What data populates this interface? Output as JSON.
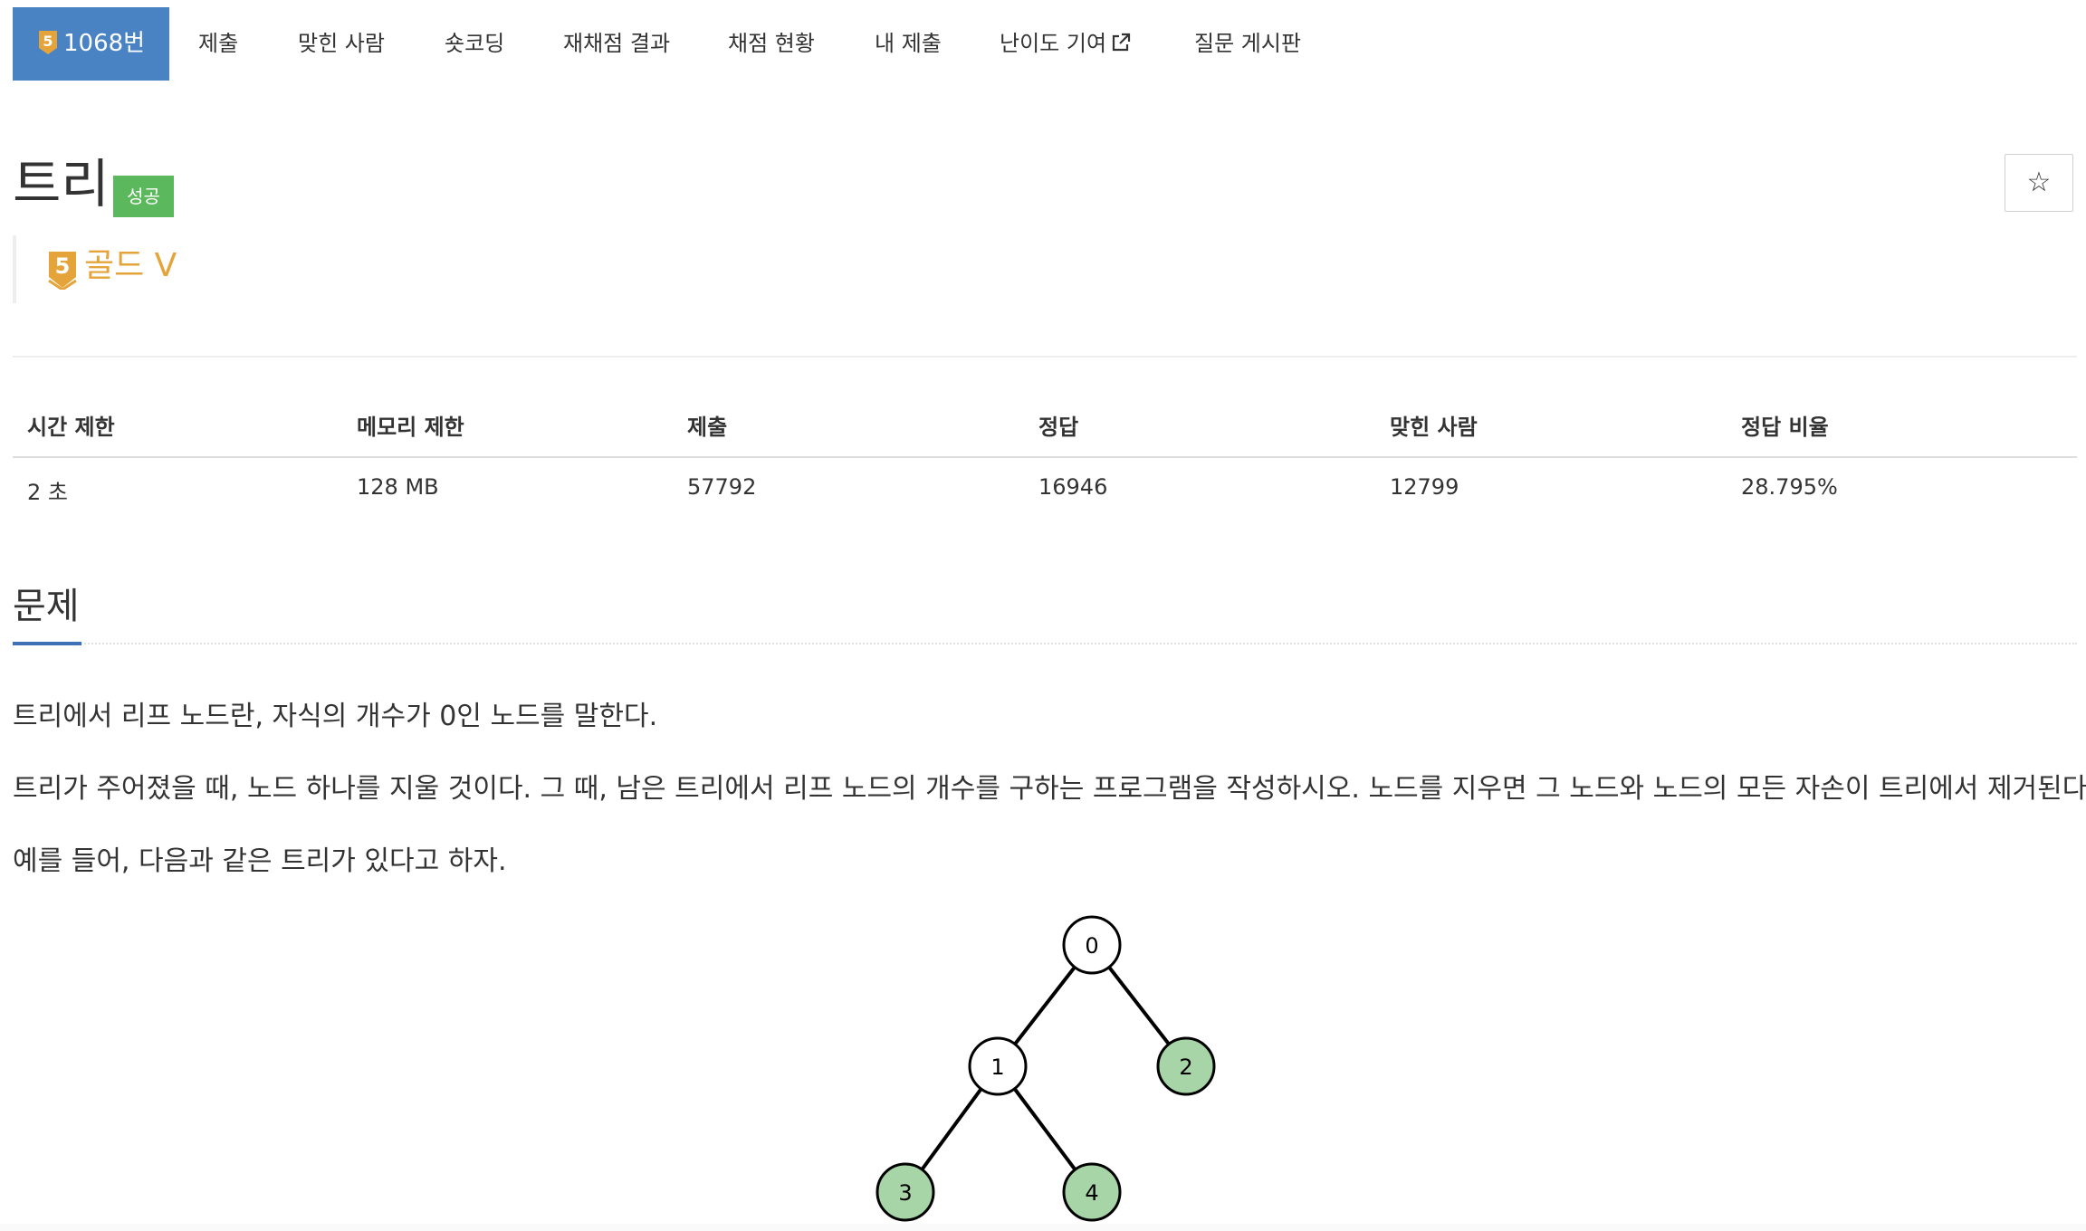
{
  "nav": {
    "problem_number": "1068번",
    "tier_digit": "5",
    "items": [
      "제출",
      "맞힌 사람",
      "숏코딩",
      "재채점 결과",
      "채점 현황",
      "내 제출",
      "난이도 기여",
      "질문 게시판"
    ]
  },
  "problem": {
    "title": "트리",
    "status_badge": "성공",
    "tier_label": "골드 V",
    "tier_digit": "5",
    "favorite_icon": "star-icon"
  },
  "info_table": {
    "headers": [
      "시간 제한",
      "메모리 제한",
      "제출",
      "정답",
      "맞힌 사람",
      "정답 비율"
    ],
    "values": [
      "2 초",
      "128 MB",
      "57792",
      "16946",
      "12799",
      "28.795%"
    ]
  },
  "section": {
    "title": "문제"
  },
  "description": [
    "트리에서 리프 노드란, 자식의 개수가 0인 노드를 말한다.",
    "트리가 주어졌을 때, 노드 하나를 지울 것이다. 그 때, 남은 트리에서 리프 노드의 개수를 구하는 프로그램을 작성하시오. 노드를 지우면 그 노드와 노드의 모든 자손이 트리에서 제거된다.",
    "예를 들어, 다음과 같은 트리가 있다고 하자."
  ],
  "tree": {
    "nodes": [
      {
        "label": "0",
        "leaf": false
      },
      {
        "label": "1",
        "leaf": false
      },
      {
        "label": "2",
        "leaf": true
      },
      {
        "label": "3",
        "leaf": true
      },
      {
        "label": "4",
        "leaf": true
      }
    ],
    "edges": [
      [
        "0",
        "1"
      ],
      [
        "0",
        "2"
      ],
      [
        "1",
        "3"
      ],
      [
        "1",
        "4"
      ]
    ]
  },
  "colors": {
    "nav_active": "#4a83c3",
    "badge_success": "#5cb85c",
    "tier_gold": "#e5a43a",
    "section_accent": "#3f71b8",
    "leaf_fill": "#a8d5a8"
  }
}
